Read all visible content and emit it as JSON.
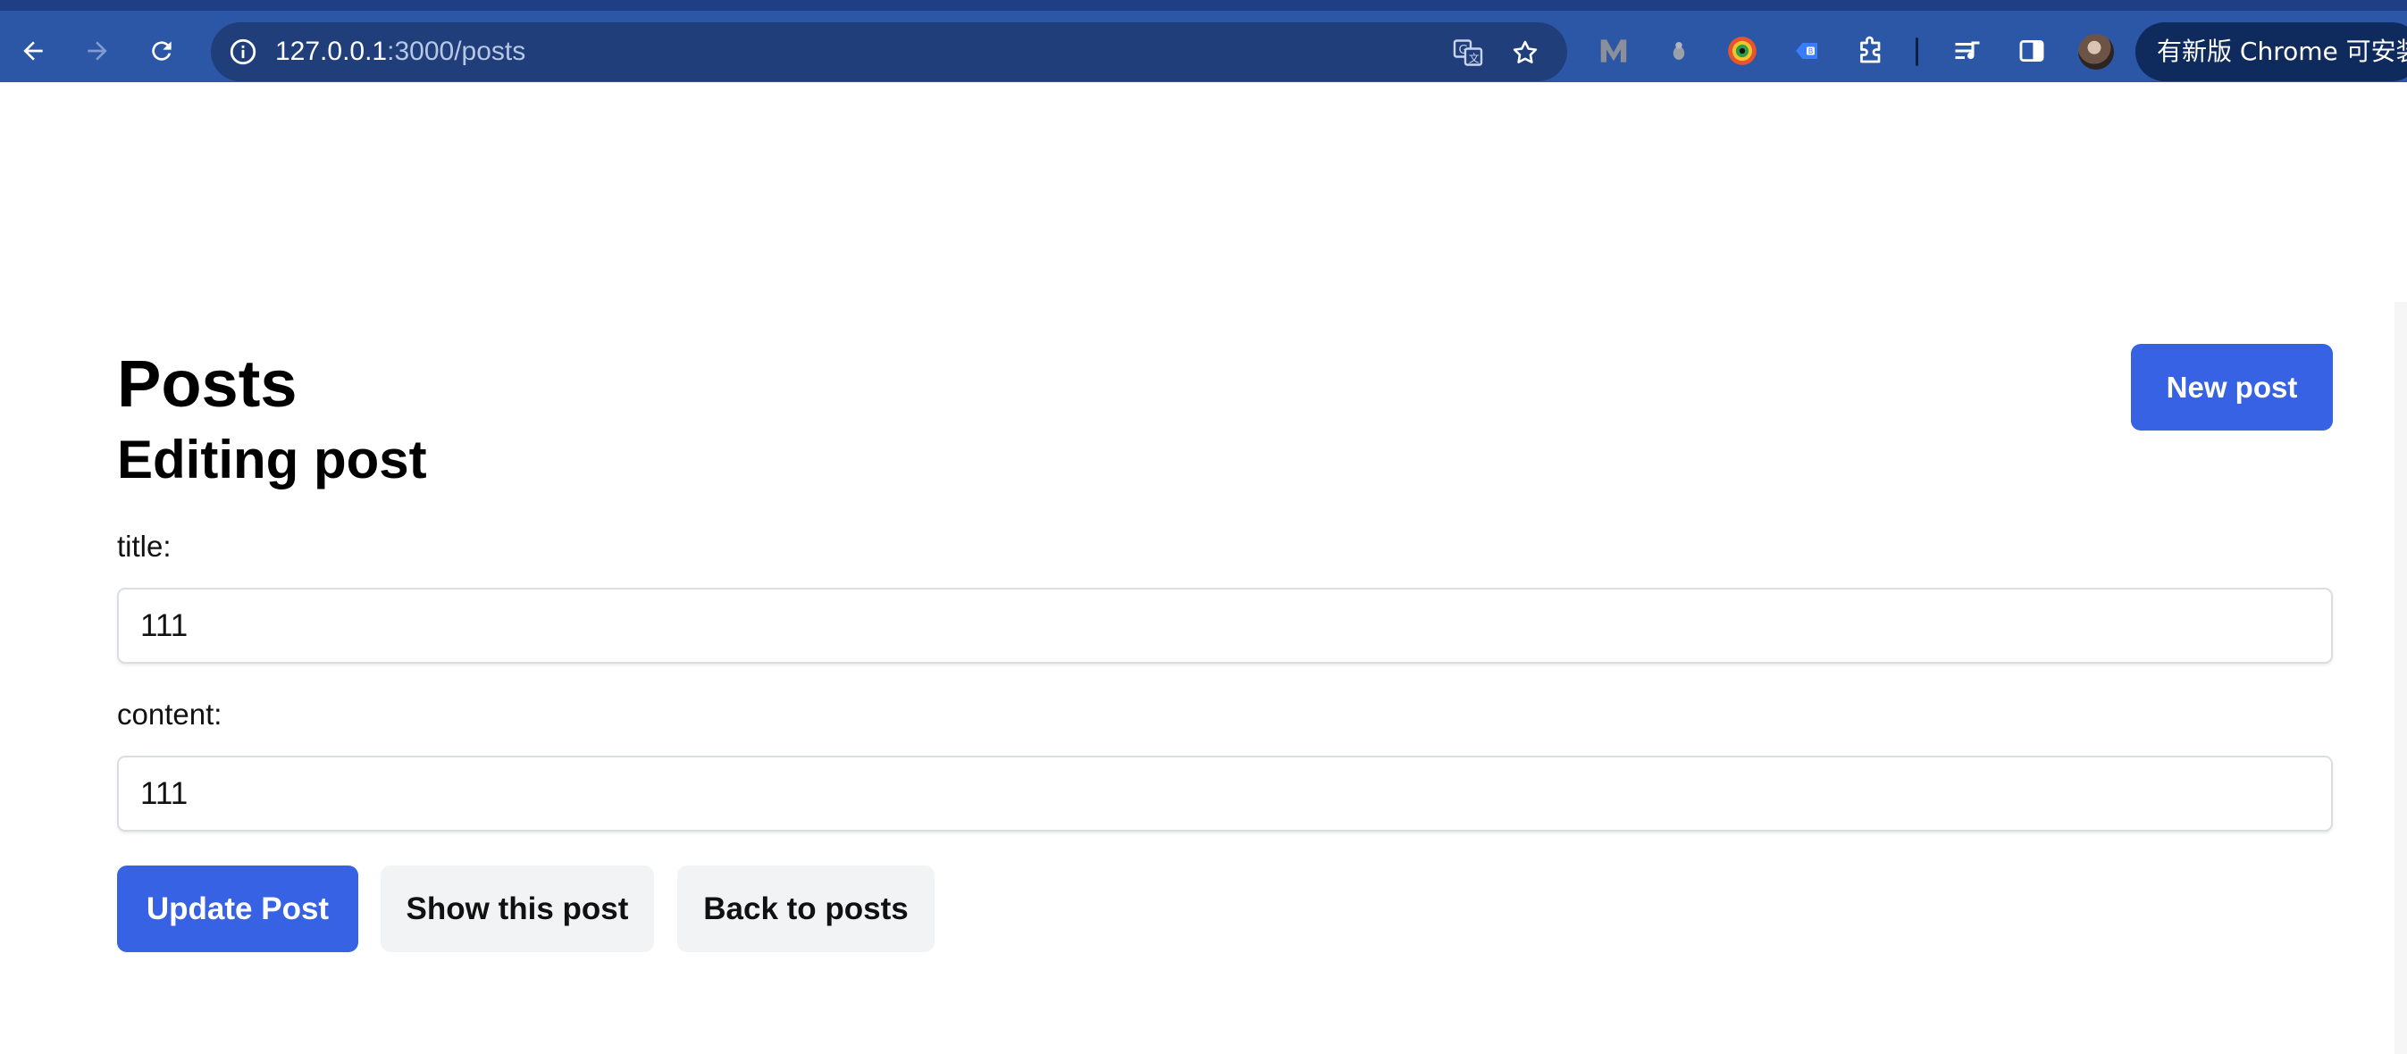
{
  "browser": {
    "url_host": "127.0.0.1",
    "url_path": ":3000/posts",
    "update_label": "有新版 Chrome 可安装",
    "icons": [
      "back-arrow-icon",
      "forward-arrow-icon",
      "reload-icon",
      "site-info-icon",
      "translate-icon",
      "bookmark-star-icon",
      "extension-m-icon",
      "extension-bell-icon",
      "extension-eye-icon",
      "extension-tag-icon",
      "extensions-puzzle-icon",
      "reading-list-icon",
      "side-panel-icon",
      "profile-avatar"
    ]
  },
  "page": {
    "heading": "Posts",
    "subheading": "Editing post",
    "new_post_label": "New post",
    "form": {
      "title_label": "title:",
      "title_value": "111",
      "content_label": "content:",
      "content_value": "111"
    },
    "actions": {
      "update_label": "Update Post",
      "show_label": "Show this post",
      "back_label": "Back to posts"
    }
  },
  "colors": {
    "toolbar": "#2c56a6",
    "omnibox": "#1f3e7a",
    "primary": "#3662e3",
    "secondary": "#f2f3f5"
  }
}
